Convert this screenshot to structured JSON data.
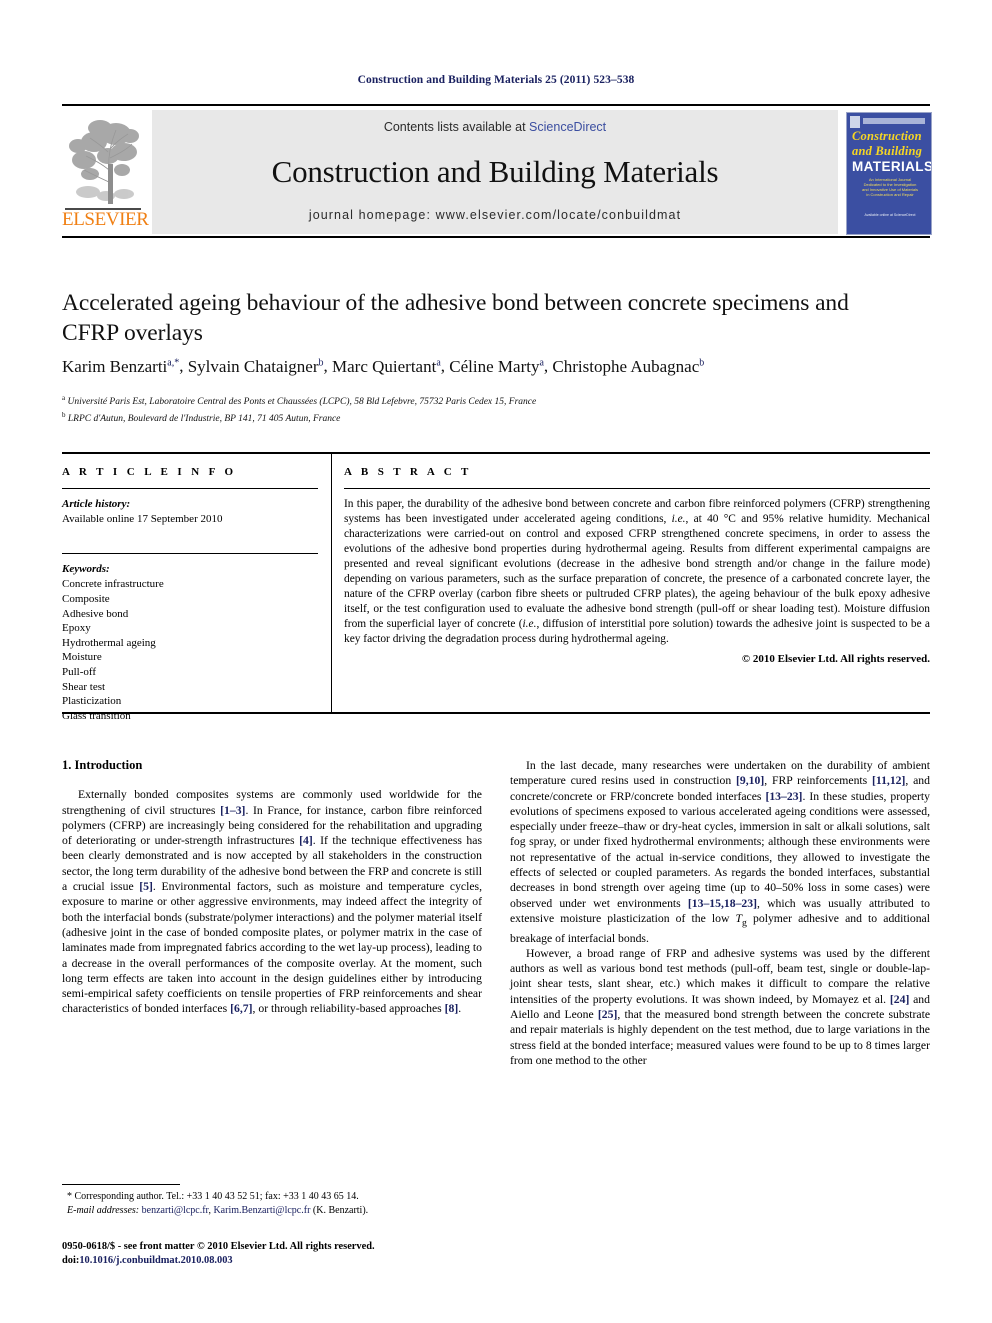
{
  "running_head": "Construction and Building Materials 25 (2011) 523–538",
  "masthead": {
    "contents_prefix": "Contents lists available at ",
    "sciencedirect": "ScienceDirect",
    "journal_title": "Construction and Building Materials",
    "homepage": "journal homepage: www.elsevier.com/locate/conbuildmat",
    "publisher_logo_text": "ELSEVIER",
    "cover": {
      "line1": "Construction",
      "line2": "and Building",
      "line3": "MATERIALS",
      "blurb": "An International Journal Dedicated to the Investigation and Innovative Use of Materials in Construction and Repair",
      "foot": "Available online at ScienceDirect"
    },
    "accent_blue": "#3b4ea0",
    "accent_orange": "#f07f13",
    "cover_bg": "#3b4fa2",
    "cover_yellow": "#f5d524"
  },
  "article": {
    "title": "Accelerated ageing behaviour of the adhesive bond between concrete specimens and CFRP overlays",
    "authors": [
      {
        "name": "Karim Benzarti",
        "marks": "a,*"
      },
      {
        "name": "Sylvain Chataigner",
        "marks": "b"
      },
      {
        "name": "Marc Quiertant",
        "marks": "a"
      },
      {
        "name": "Céline Marty",
        "marks": "a"
      },
      {
        "name": "Christophe Aubagnac",
        "marks": "b"
      }
    ],
    "affiliations": [
      {
        "mark": "a",
        "text": "Université Paris Est, Laboratoire Central des Ponts et Chaussées (LCPC), 58 Bld Lefebvre, 75732 Paris Cedex 15, France"
      },
      {
        "mark": "b",
        "text": "LRPC d'Autun, Boulevard de l'Industrie, BP 141, 71 405 Autun, France"
      }
    ]
  },
  "article_info": {
    "heading": "A R T I C L E    I N F O",
    "history_label": "Article history:",
    "history_value": "Available online 17 September 2010",
    "keywords_label": "Keywords:",
    "keywords": [
      "Concrete infrastructure",
      "Composite",
      "Adhesive bond",
      "Epoxy",
      "Hydrothermal ageing",
      "Moisture",
      "Pull-off",
      "Shear test",
      "Plasticization",
      "Glass transition"
    ]
  },
  "abstract": {
    "heading": "A B S T R A C T",
    "paragraph_parts": [
      {
        "t": "In this paper, the durability of the adhesive bond between concrete and carbon fibre reinforced polymers (CFRP) strengthening systems has been investigated under accelerated ageing conditions, "
      },
      {
        "t": "i.e.",
        "i": true
      },
      {
        "t": ", at 40 °C and 95% relative humidity. Mechanical characterizations were carried-out on control and exposed CFRP strengthened concrete specimens, in order to assess the evolutions of the adhesive bond properties during hydrothermal ageing. Results from different experimental campaigns are presented and reveal significant evolutions (decrease in the adhesive bond strength and/or change in the failure mode) depending on various parameters, such as the surface preparation of concrete, the presence of a carbonated concrete layer, the nature of the CFRP overlay (carbon fibre sheets or pultruded CFRP plates), the ageing behaviour of the bulk epoxy adhesive itself, or the test configuration used to evaluate the adhesive bond strength (pull-off or shear loading test). Moisture diffusion from the superficial layer of concrete ("
      },
      {
        "t": "i.e.",
        "i": true
      },
      {
        "t": ", diffusion of interstitial pore solution) towards the adhesive joint is suspected to be a key factor driving the degradation process during hydrothermal ageing."
      }
    ],
    "copyright": "© 2010 Elsevier Ltd. All rights reserved."
  },
  "body": {
    "section_heading": "1. Introduction",
    "left_paragraphs": [
      [
        {
          "t": "Externally bonded composites systems are commonly used worldwide for the strengthening of civil structures "
        },
        {
          "t": "[1–3]",
          "ref": true
        },
        {
          "t": ". In France, for instance, carbon fibre reinforced polymers (CFRP) are increasingly being considered for the rehabilitation and upgrading of deteriorating or under-strength infrastructures "
        },
        {
          "t": "[4]",
          "ref": true
        },
        {
          "t": ". If the technique effectiveness has been clearly demonstrated and is now accepted by all stakeholders in the construction sector, the long term durability of the adhesive bond between the FRP and concrete is still a crucial issue "
        },
        {
          "t": "[5]",
          "ref": true
        },
        {
          "t": ". Environmental factors, such as moisture and temperature cycles, exposure to marine or other aggressive environments, may indeed affect the integrity of both the interfacial bonds (substrate/polymer interactions) and the polymer material itself (adhesive joint in the case of bonded composite plates, or polymer matrix in the case of laminates made from impregnated fabrics according to the wet lay-up process), leading to a decrease in the overall performances of the composite overlay. At the moment, such long term effects are taken into account in the design guidelines either by introducing semi-empirical safety coefficients on tensile properties of FRP reinforcements and shear characteristics of bonded interfaces "
        },
        {
          "t": "[6,7]",
          "ref": true
        },
        {
          "t": ", or through reliability-based approaches "
        },
        {
          "t": "[8]",
          "ref": true
        },
        {
          "t": "."
        }
      ]
    ],
    "right_paragraphs": [
      [
        {
          "t": "In the last decade, many researches were undertaken on the durability of ambient temperature cured resins used in construction "
        },
        {
          "t": "[9,10]",
          "ref": true
        },
        {
          "t": ", FRP reinforcements "
        },
        {
          "t": "[11,12]",
          "ref": true
        },
        {
          "t": ", and concrete/concrete or FRP/concrete bonded interfaces "
        },
        {
          "t": "[13–23]",
          "ref": true
        },
        {
          "t": ". In these studies, property evolutions of specimens exposed to various accelerated ageing conditions were assessed, especially under freeze–thaw or dry-heat cycles, immersion in salt or alkali solutions, salt fog spray, or under fixed hydrothermal environments; although these environments were not representative of the actual in-service conditions, they allowed to investigate the effects of selected or coupled parameters. As regards the bonded interfaces, substantial decreases in bond strength over ageing time (up to 40–50% loss in some cases) were observed under wet environments "
        },
        {
          "t": "[13–15,18–23]",
          "ref": true
        },
        {
          "t": ", which was usually attributed to extensive moisture plasticization of the low "
        },
        {
          "t": "Tg",
          "sub": true
        },
        {
          "t": " polymer adhesive and to additional breakage of interfacial bonds."
        }
      ],
      [
        {
          "t": "However, a broad range of FRP and adhesive systems was used by the different authors as well as various bond test methods (pull-off, beam test, single or double-lap-joint shear tests, slant shear, etc.) which makes it difficult to compare the relative intensities of the property evolutions. It was shown indeed, by Momayez et al. "
        },
        {
          "t": "[24]",
          "ref": true
        },
        {
          "t": " and Aiello and Leone "
        },
        {
          "t": "[25]",
          "ref": true
        },
        {
          "t": ", that the measured bond strength between the concrete substrate and repair materials is highly dependent on the test method, due to large variations in the stress field at the bonded interface; measured values were found to be up to 8 times larger from one method to the other"
        }
      ]
    ]
  },
  "footnote": {
    "corresponding": "* Corresponding author. Tel.: +33 1 40 43 52 51; fax: +33 1 40 43 65 14.",
    "email_label": "E-mail addresses:",
    "email1": "benzarti@lcpc.fr",
    "email2": "Karim.Benzarti@lcpc.fr",
    "email_suffix": "(K. Benzarti)."
  },
  "footer": {
    "issn_line": "0950-0618/$ - see front matter © 2010 Elsevier Ltd. All rights reserved.",
    "doi_label": "doi:",
    "doi_value": "10.1016/j.conbuildmat.2010.08.003"
  }
}
